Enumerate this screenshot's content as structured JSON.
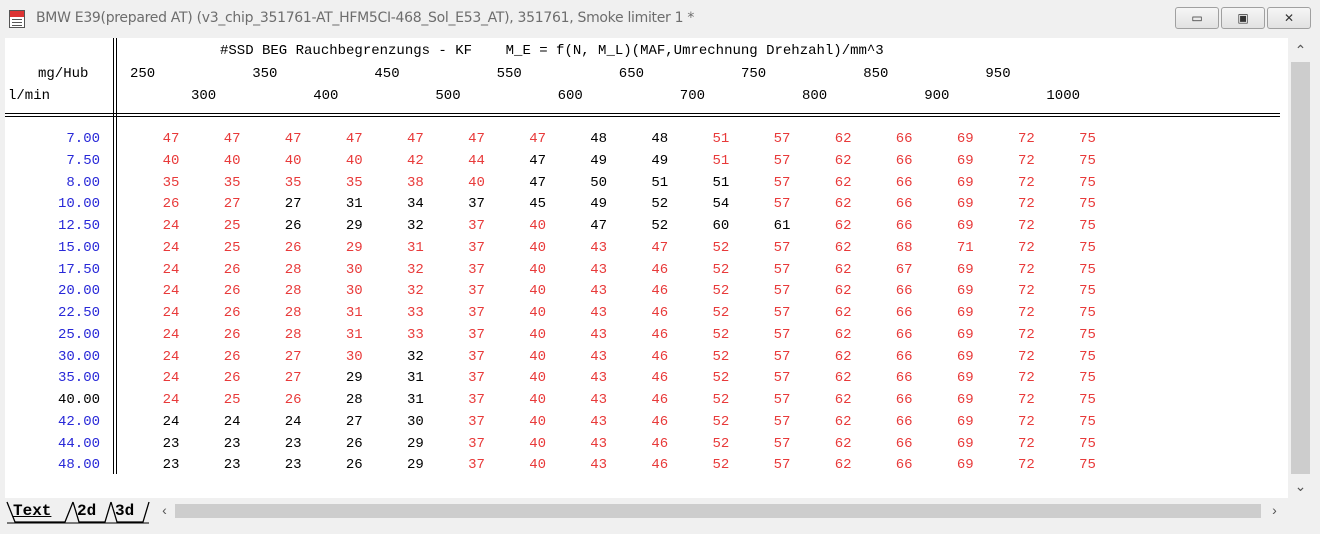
{
  "window": {
    "title": "BMW E39(prepared AT) (v3_chip_351761-AT_HFM5CI-468_Sol_E53_AT), 351761, Smoke limiter 1 *",
    "minimize_label": "▭",
    "maximize_label": "▣",
    "close_label": "✕"
  },
  "map": {
    "header_line": "#SSD BEG Rauchbegrenzungs - KF    M_E = f(N, M_L)(MAF,Umrechnung Drehzahl)/mm^3",
    "y_unit": "mg/Hub",
    "x_unit": "l/min",
    "x_axis_upper": [
      "250",
      "350",
      "450",
      "550",
      "650",
      "750",
      "850",
      "950"
    ],
    "x_axis_lower": [
      "300",
      "400",
      "500",
      "600",
      "700",
      "800",
      "900",
      "1000"
    ],
    "rows": [
      {
        "label": "7.00",
        "values": [
          "47",
          "47",
          "47",
          "47",
          "47",
          "47",
          "47",
          "48",
          "48",
          "51",
          "57",
          "62",
          "66",
          "69",
          "72",
          "75"
        ]
      },
      {
        "label": "7.50",
        "values": [
          "40",
          "40",
          "40",
          "40",
          "42",
          "44",
          "47",
          "49",
          "49",
          "51",
          "57",
          "62",
          "66",
          "69",
          "72",
          "75"
        ]
      },
      {
        "label": "8.00",
        "values": [
          "35",
          "35",
          "35",
          "35",
          "38",
          "40",
          "47",
          "50",
          "51",
          "51",
          "57",
          "62",
          "66",
          "69",
          "72",
          "75"
        ]
      },
      {
        "label": "10.00",
        "values": [
          "26",
          "27",
          "27",
          "31",
          "34",
          "37",
          "45",
          "49",
          "52",
          "54",
          "57",
          "62",
          "66",
          "69",
          "72",
          "75"
        ]
      },
      {
        "label": "12.50",
        "values": [
          "24",
          "25",
          "26",
          "29",
          "32",
          "37",
          "40",
          "47",
          "52",
          "60",
          "61",
          "62",
          "66",
          "69",
          "72",
          "75"
        ]
      },
      {
        "label": "15.00",
        "values": [
          "24",
          "25",
          "26",
          "29",
          "31",
          "37",
          "40",
          "43",
          "47",
          "52",
          "57",
          "62",
          "68",
          "71",
          "72",
          "75"
        ]
      },
      {
        "label": "17.50",
        "values": [
          "24",
          "26",
          "28",
          "30",
          "32",
          "37",
          "40",
          "43",
          "46",
          "52",
          "57",
          "62",
          "67",
          "69",
          "72",
          "75"
        ]
      },
      {
        "label": "20.00",
        "values": [
          "24",
          "26",
          "28",
          "30",
          "32",
          "37",
          "40",
          "43",
          "46",
          "52",
          "57",
          "62",
          "66",
          "69",
          "72",
          "75"
        ]
      },
      {
        "label": "22.50",
        "values": [
          "24",
          "26",
          "28",
          "31",
          "33",
          "37",
          "40",
          "43",
          "46",
          "52",
          "57",
          "62",
          "66",
          "69",
          "72",
          "75"
        ]
      },
      {
        "label": "25.00",
        "values": [
          "24",
          "26",
          "28",
          "31",
          "33",
          "37",
          "40",
          "43",
          "46",
          "52",
          "57",
          "62",
          "66",
          "69",
          "72",
          "75"
        ]
      },
      {
        "label": "30.00",
        "values": [
          "24",
          "26",
          "27",
          "30",
          "32",
          "37",
          "40",
          "43",
          "46",
          "52",
          "57",
          "62",
          "66",
          "69",
          "72",
          "75"
        ]
      },
      {
        "label": "35.00",
        "values": [
          "24",
          "26",
          "27",
          "29",
          "31",
          "37",
          "40",
          "43",
          "46",
          "52",
          "57",
          "62",
          "66",
          "69",
          "72",
          "75"
        ]
      },
      {
        "label": "40.00",
        "values": [
          "24",
          "25",
          "26",
          "28",
          "31",
          "37",
          "40",
          "43",
          "46",
          "52",
          "57",
          "62",
          "66",
          "69",
          "72",
          "75"
        ]
      },
      {
        "label": "42.00",
        "values": [
          "24",
          "24",
          "24",
          "27",
          "30",
          "37",
          "40",
          "43",
          "46",
          "52",
          "57",
          "62",
          "66",
          "69",
          "72",
          "75"
        ]
      },
      {
        "label": "44.00",
        "values": [
          "23",
          "23",
          "23",
          "26",
          "29",
          "37",
          "40",
          "43",
          "46",
          "52",
          "57",
          "62",
          "66",
          "69",
          "72",
          "75"
        ]
      },
      {
        "label": "48.00",
        "values": [
          "23",
          "23",
          "23",
          "26",
          "29",
          "37",
          "40",
          "43",
          "46",
          "52",
          "57",
          "62",
          "66",
          "69",
          "72",
          "75"
        ]
      }
    ],
    "black_cells": [
      [
        0,
        7
      ],
      [
        0,
        8
      ],
      [
        1,
        6
      ],
      [
        1,
        7
      ],
      [
        1,
        8
      ],
      [
        2,
        6
      ],
      [
        2,
        7
      ],
      [
        2,
        8
      ],
      [
        2,
        9
      ],
      [
        3,
        2
      ],
      [
        3,
        3
      ],
      [
        3,
        4
      ],
      [
        3,
        5
      ],
      [
        3,
        6
      ],
      [
        3,
        7
      ],
      [
        3,
        8
      ],
      [
        3,
        9
      ],
      [
        4,
        2
      ],
      [
        4,
        3
      ],
      [
        4,
        4
      ],
      [
        4,
        7
      ],
      [
        4,
        8
      ],
      [
        4,
        9
      ],
      [
        4,
        10
      ],
      [
        10,
        4
      ],
      [
        11,
        3
      ],
      [
        11,
        4
      ],
      [
        12,
        3
      ],
      [
        12,
        4
      ],
      [
        13,
        0
      ],
      [
        13,
        1
      ],
      [
        13,
        2
      ],
      [
        13,
        3
      ],
      [
        13,
        4
      ],
      [
        14,
        0
      ],
      [
        14,
        1
      ],
      [
        14,
        2
      ],
      [
        14,
        3
      ],
      [
        14,
        4
      ],
      [
        15,
        0
      ],
      [
        15,
        1
      ],
      [
        15,
        2
      ],
      [
        15,
        3
      ],
      [
        15,
        4
      ]
    ],
    "black_labels": [
      12
    ],
    "colors": {
      "changed": "#e83a3a",
      "unchanged": "#000000",
      "axis": "#2828d8"
    }
  },
  "tabs": [
    {
      "label": "Text",
      "active": true
    },
    {
      "label": "2d",
      "active": false
    },
    {
      "label": "3d",
      "active": false
    }
  ],
  "scroll": {
    "up": "⌃",
    "down": "⌄",
    "left": "‹",
    "right": "›"
  }
}
